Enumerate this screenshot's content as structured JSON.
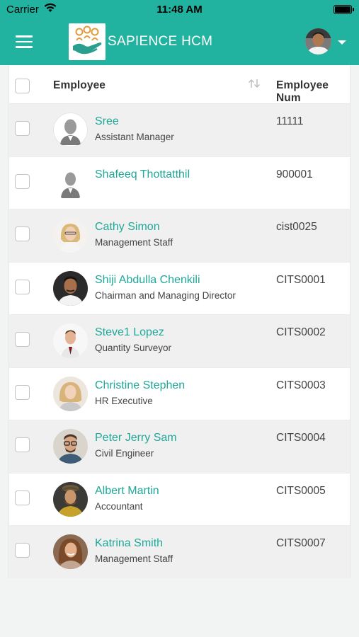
{
  "status_bar": {
    "carrier": "Carrier",
    "time": "11:48 AM"
  },
  "header": {
    "brand": "SAPIENCE HCM",
    "menu_icon": "hamburger-menu-icon",
    "accent_color": "#22b3a0"
  },
  "table": {
    "columns": {
      "employee": "Employee",
      "employee_number": "Employee Num"
    },
    "rows": [
      {
        "name": "Sree",
        "role": "Assistant Manager",
        "emp_no": "11111",
        "avatar": "placeholder"
      },
      {
        "name": "Shafeeq Thottatthil",
        "role": "",
        "emp_no": "900001",
        "avatar": "placeholder"
      },
      {
        "name": "Cathy Simon",
        "role": "Management Staff",
        "emp_no": "cist0025",
        "avatar": "photo"
      },
      {
        "name": "Shiji Abdulla Chenkili",
        "role": "Chairman and Managing Director",
        "emp_no": "CITS0001",
        "avatar": "photo"
      },
      {
        "name": "Steve1 Lopez",
        "role": "Quantity Surveyor",
        "emp_no": "CITS0002",
        "avatar": "photo"
      },
      {
        "name": "Christine Stephen",
        "role": "HR Executive",
        "emp_no": "CITS0003",
        "avatar": "photo"
      },
      {
        "name": "Peter Jerry Sam",
        "role": "Civil Engineer",
        "emp_no": "CITS0004",
        "avatar": "photo"
      },
      {
        "name": "Albert Martin",
        "role": "Accountant",
        "emp_no": "CITS0005",
        "avatar": "photo"
      },
      {
        "name": "Katrina Smith",
        "role": "Management Staff",
        "emp_no": "CITS0007",
        "avatar": "photo"
      }
    ]
  }
}
